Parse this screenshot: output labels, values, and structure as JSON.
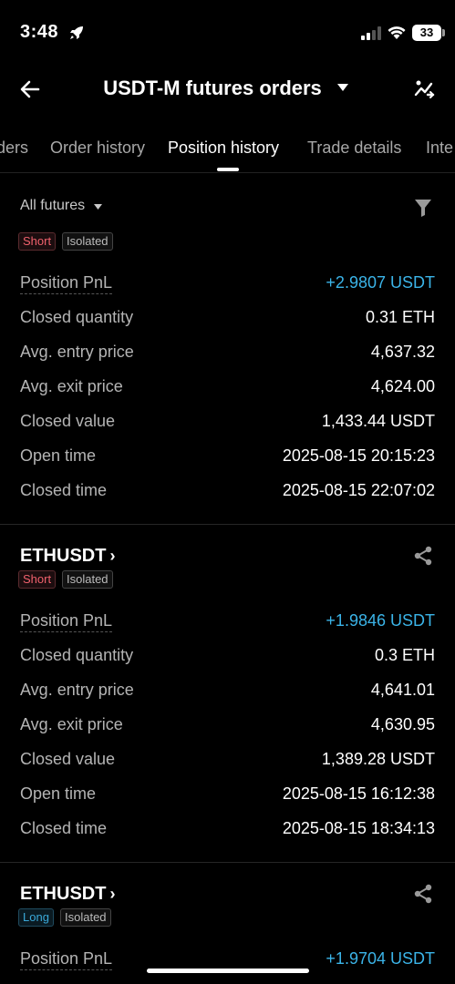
{
  "status": {
    "time": "3:48",
    "battery": "33"
  },
  "header": {
    "title": "USDT-M futures orders"
  },
  "tabs": [
    "ders",
    "Order history",
    "Position history",
    "Trade details",
    "Inte"
  ],
  "filter": {
    "label": "All futures"
  },
  "cards": [
    {
      "symbol": "",
      "side": "Short",
      "margin": "Isolated",
      "rows": [
        {
          "label": "Position PnL",
          "value": "+2.9807 USDT"
        },
        {
          "label": "Closed quantity",
          "value": "0.31 ETH"
        },
        {
          "label": "Avg. entry price",
          "value": "4,637.32"
        },
        {
          "label": "Avg. exit price",
          "value": "4,624.00"
        },
        {
          "label": "Closed value",
          "value": "1,433.44 USDT"
        },
        {
          "label": "Open time",
          "value": "2025-08-15 20:15:23"
        },
        {
          "label": "Closed time",
          "value": "2025-08-15 22:07:02"
        }
      ]
    },
    {
      "symbol": "ETHUSDT",
      "side": "Short",
      "margin": "Isolated",
      "rows": [
        {
          "label": "Position PnL",
          "value": "+1.9846 USDT"
        },
        {
          "label": "Closed quantity",
          "value": "0.3 ETH"
        },
        {
          "label": "Avg. entry price",
          "value": "4,641.01"
        },
        {
          "label": "Avg. exit price",
          "value": "4,630.95"
        },
        {
          "label": "Closed value",
          "value": "1,389.28 USDT"
        },
        {
          "label": "Open time",
          "value": "2025-08-15 16:12:38"
        },
        {
          "label": "Closed time",
          "value": "2025-08-15 18:34:13"
        }
      ]
    },
    {
      "symbol": "ETHUSDT",
      "side": "Long",
      "margin": "Isolated",
      "rows": [
        {
          "label": "Position PnL",
          "value": "+1.9704 USDT"
        }
      ]
    }
  ],
  "colors": {
    "pnl": "#3bb4e8",
    "short": "#f0616d",
    "long": "#3aa8d8",
    "background": "#000000"
  }
}
